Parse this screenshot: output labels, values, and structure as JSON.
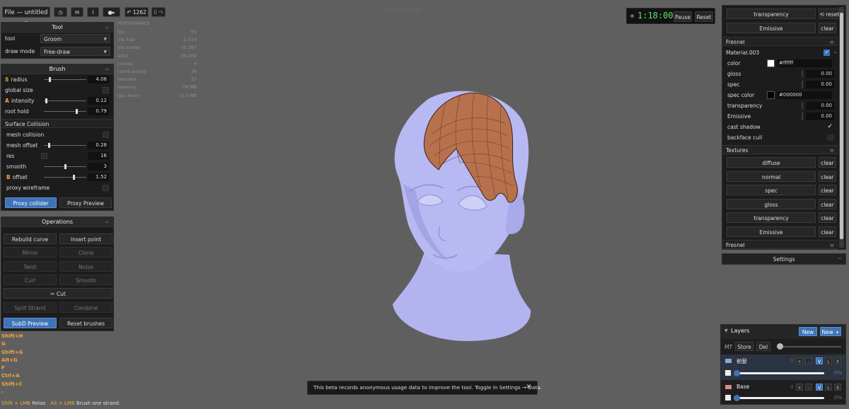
{
  "topbar": {
    "file_label": "File — untitled *",
    "undo_count": "↶ 1262",
    "redo_count": "0 ↷",
    "center_text": "sculpt @ 60 fps"
  },
  "tool_panel": {
    "title": "Tool",
    "tool_label": "tool",
    "tool_value": "Groom",
    "mode_label": "draw mode",
    "mode_value": "Free-draw"
  },
  "brush_panel": {
    "title": "Brush",
    "radius": {
      "key": "S",
      "label": "radius",
      "value": "4.06",
      "level": 0.12
    },
    "global_size": {
      "label": "global size"
    },
    "intensity": {
      "key": "A",
      "label": "intensity",
      "value": "0.12",
      "level": 0.03
    },
    "root_hold": {
      "label": "root hold",
      "value": "0.79",
      "level": 0.79
    }
  },
  "collision": {
    "title": "Surface Collision",
    "mesh_collision": "mesh collision",
    "mesh_offset": {
      "label": "mesh offset",
      "value": "0.28",
      "level": 0.1
    },
    "res": {
      "label": "res",
      "value": "16"
    },
    "smooth": {
      "label": "smooth",
      "value": "3",
      "level": 0.5
    },
    "offset": {
      "key": "B",
      "label": "offset",
      "value": "1.52",
      "level": 0.72
    },
    "proxy_wireframe": "proxy wireframe",
    "proxy_collider": "Proxy collider",
    "proxy_preview": "Proxy Preview"
  },
  "operations": {
    "title": "Operations",
    "rebuild_curve": "Rebuild curve",
    "insert_point": "Insert point",
    "mirror": "Mirror",
    "clone": "Clone",
    "twist": "Twist",
    "noise": "Noise",
    "curl": "Curl",
    "smooth": "Smooth",
    "cut": "✂ Cut",
    "split_strand": "Split Strand",
    "combine": "Combine",
    "subd_preview": "SubD Preview",
    "reset_brushes": "Reset brushes"
  },
  "shortcuts": [
    "Shift+H",
    "G",
    "Shift+G",
    "Alt+G",
    "F",
    "Ctrl+A",
    "Shift+C",
    "-"
  ],
  "footer_hint": {
    "a_key": "Shift + LMB",
    "a_text": "Relax",
    "b_key": "Alt + LMB",
    "b_text": "Brush one strand"
  },
  "performance": {
    "title": "PERFORMANCE",
    "rows": [
      {
        "label": "fps",
        "value": "60"
      },
      {
        "label": "tris hair",
        "value": "1,024"
      },
      {
        "label": "tris scene",
        "value": "35,087"
      },
      {
        "label": "total",
        "value": "36,169"
      },
      {
        "label": "curves",
        "value": "4"
      },
      {
        "label": "curve points",
        "value": "36"
      },
      {
        "label": "textures",
        "value": "37"
      },
      {
        "label": "memory",
        "value": "78 MB"
      },
      {
        "label": "gpu mem",
        "value": "~3.3 MB"
      }
    ]
  },
  "timer": {
    "value": "1:18:00",
    "pause": "Pause",
    "reset": "Reset"
  },
  "material": {
    "top_transparency": "transparency",
    "top_reset": "⟲ reset",
    "top_emissive": "Emissive",
    "top_clear": "clear",
    "fresnel": "Fresnel",
    "name": "Material.003",
    "color": {
      "label": "color",
      "hex": "#ffffff"
    },
    "gloss": {
      "label": "gloss",
      "value": "0.00"
    },
    "spec": {
      "label": "spec",
      "value": "0.00"
    },
    "spec_color": {
      "label": "spec color",
      "hex": "#000000"
    },
    "transparency": {
      "label": "transparency",
      "value": "0.00"
    },
    "emissive": {
      "label": "Emissive",
      "value": "0.00"
    },
    "cast_shadow": "cast shadow",
    "backface_cull": "backface cull",
    "textures_title": "Textures",
    "textures": [
      "diffuse",
      "normal",
      "spec",
      "gloss",
      "transparency",
      "Emissive"
    ],
    "clear": "clear",
    "fresnel2": "Fresnel"
  },
  "settings": {
    "label": "Settings"
  },
  "layers": {
    "title": "Layers",
    "new": "New",
    "new_plus": "New +",
    "mt": "MT",
    "store": "Store",
    "del": "Del",
    "items": [
      {
        "name": "前髪",
        "count": "0",
        "plus": "+",
        "minus": "-",
        "v": "V",
        "l": "L",
        "x": "X",
        "opacity": "0%",
        "color": "#8fa6d8"
      },
      {
        "name": "Base",
        "count": "0",
        "plus": "+",
        "minus": "-",
        "v": "V",
        "l": "L",
        "x": "X",
        "opacity": "0%",
        "color": "#d88a8a"
      }
    ]
  },
  "toast": {
    "text": "This beta records anonymous usage data to improve the tool. Toggle in Settings → Data.",
    "close": "✕"
  }
}
